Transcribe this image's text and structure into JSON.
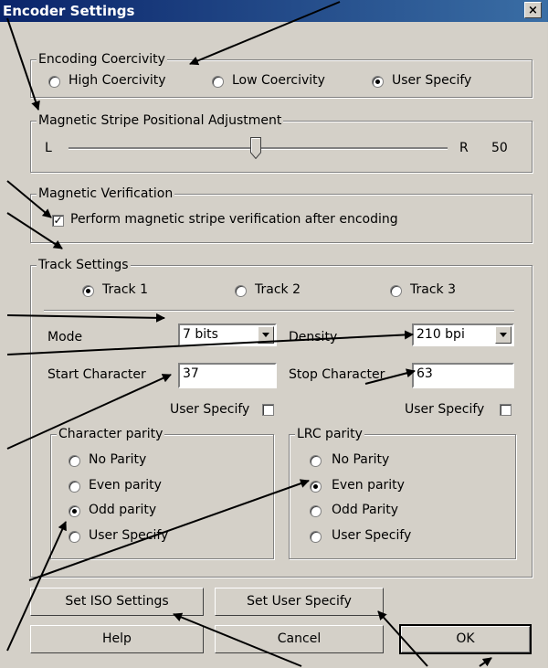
{
  "window": {
    "title": "Encoder Settings",
    "close_glyph": "×"
  },
  "coercivity": {
    "legend": "Encoding Coercivity",
    "options": [
      "High Coercivity",
      "Low Coercivity",
      "User Specify"
    ],
    "selected": "User Specify"
  },
  "adjust": {
    "legend": "Magnetic Stripe Positional Adjustment",
    "left": "L",
    "right": "R",
    "value": "50"
  },
  "verification": {
    "legend": "Magnetic Verification",
    "checkbox_label": "Perform magnetic stripe verification after encoding",
    "checked": true
  },
  "track": {
    "legend": "Track Settings",
    "tabs": [
      "Track 1",
      "Track 2",
      "Track 3"
    ],
    "selected": "Track 1",
    "mode_label": "Mode",
    "mode_value": "7 bits",
    "density_label": "Density",
    "density_value": "210 bpi",
    "start_label": "Start Character",
    "start_value": "37",
    "stop_label": "Stop Character",
    "stop_value": "63",
    "user_specify_1": "User Specify",
    "user_specify_2": "User Specify"
  },
  "char_parity": {
    "legend": "Character parity",
    "options": [
      "No Parity",
      "Even parity",
      "Odd parity",
      "User Specify"
    ],
    "selected": "Odd parity"
  },
  "lrc_parity": {
    "legend": "LRC parity",
    "options": [
      "No Parity",
      "Even parity",
      "Odd Parity",
      "User Specify"
    ],
    "selected": "Even parity"
  },
  "buttons": {
    "iso": "Set ISO Settings",
    "user": "Set User Specify",
    "help": "Help",
    "cancel": "Cancel",
    "ok": "OK"
  }
}
